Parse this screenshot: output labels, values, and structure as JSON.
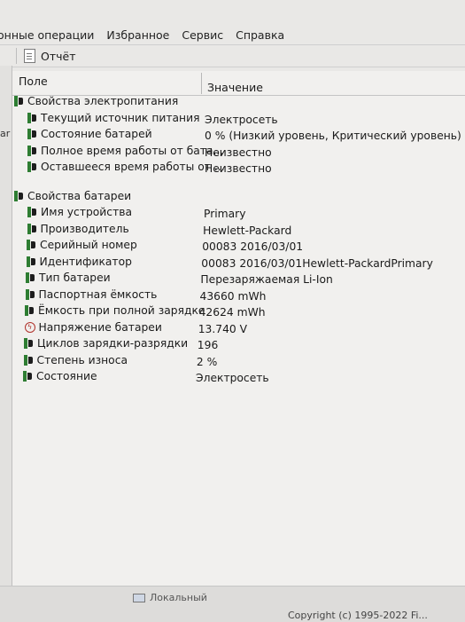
{
  "menu": {
    "items": [
      "онные операции",
      "Избранное",
      "Сервис",
      "Справка"
    ]
  },
  "toolbar": {
    "report_label": "Отчёт"
  },
  "left_fragment": "ar",
  "columns": {
    "field": "Поле",
    "value": "Значение"
  },
  "groups": [
    {
      "title": "Свойства электропитания",
      "rows": [
        {
          "name": "Текущий источник питания",
          "value": "Электросеть"
        },
        {
          "name": "Состояние батарей",
          "value": "0 % (Низкий уровень, Критический уровень)"
        },
        {
          "name": "Полное время работы от бата...",
          "value": "Неизвестно"
        },
        {
          "name": "Оставшееся время работы от ...",
          "value": "Неизвестно"
        }
      ]
    },
    {
      "title": "Свойства батареи",
      "rows": [
        {
          "name": "Имя устройства",
          "value": "Primary"
        },
        {
          "name": "Производитель",
          "value": "Hewlett-Packard"
        },
        {
          "name": "Серийный номер",
          "value": "00083 2016/03/01"
        },
        {
          "name": "Идентификатор",
          "value": "00083 2016/03/01Hewlett-PackardPrimary"
        },
        {
          "name": "Тип батареи",
          "value": "Перезаряжаемая Li-Ion"
        },
        {
          "name": "Паспортная ёмкость",
          "value": "43660 mWh"
        },
        {
          "name": "Ёмкость при полной зарядке",
          "value": "42624 mWh"
        },
        {
          "name": "Напряжение батареи",
          "value": "13.740 V",
          "icon": "voltage-icon"
        },
        {
          "name": "Циклов зарядки-разрядки",
          "value": "196"
        },
        {
          "name": "Степень износа",
          "value": "2 %"
        },
        {
          "name": "Состояние",
          "value": "Электросеть"
        }
      ]
    }
  ],
  "status": {
    "local": "Локальный",
    "copyright": "Copyright (c) 1995-2022 Fi..."
  },
  "icons": {
    "power": "power-plug-icon",
    "voltage": "voltage-icon",
    "report": "report-document-icon"
  }
}
